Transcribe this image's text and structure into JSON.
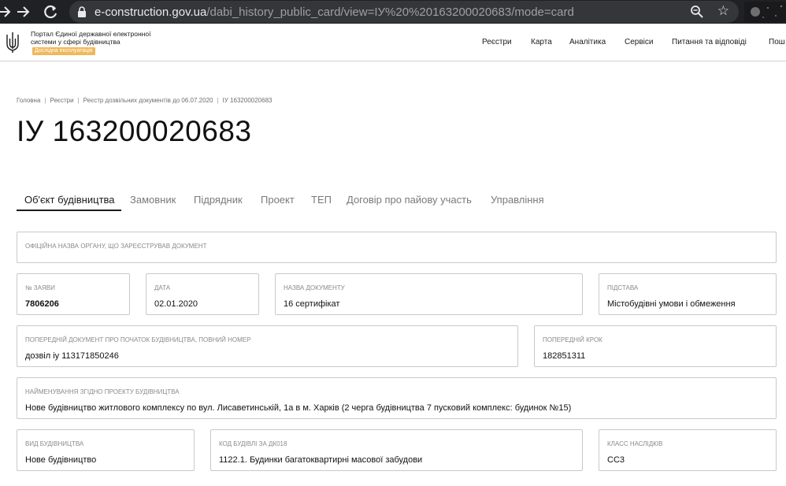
{
  "browser": {
    "url_host": "e-construction.gov.ua",
    "url_path": "/dabi_history_public_card/view=ІУ%20%20163200020683/mode=card"
  },
  "header": {
    "logo_text": "Портал Єдиної державної електронної системи у сфері будівництва",
    "beta_badge": "Дослідна експлуатація",
    "nav": [
      "Реєстри",
      "Карта",
      "Аналітика",
      "Сервіси",
      "Питання та відповіді",
      "Пош"
    ]
  },
  "breadcrumb": [
    "Головна",
    "Реєстри",
    "Реєстр дозвільних документів до 06.07.2020",
    "ІУ 163200020683"
  ],
  "title": "ІУ 163200020683",
  "tabs": [
    "Об'єкт будівництва",
    "Замовник",
    "Підрядник",
    "Проект",
    "ТЕП",
    "Договір про пайову участь",
    "Управління"
  ],
  "fields": {
    "issuing_body": {
      "label": "Офіційна назва органу, що зареєстрував документ",
      "value": ""
    },
    "application_no": {
      "label": "№ заяви",
      "value": "7806206"
    },
    "date": {
      "label": "Дата",
      "value": "02.01.2020"
    },
    "doc_name": {
      "label": "Назва документу",
      "value": "16 сертифікат"
    },
    "basis": {
      "label": "Підстава",
      "value": "Містобудівні умови і обмеження"
    },
    "prev_document": {
      "label": "Попередній документ про початок будівництва, повний номер",
      "value": "дозвіл іу 113171850246"
    },
    "prev_step": {
      "label": "Попередній крок",
      "value": "182851311"
    },
    "project_name": {
      "label": "Найменування згідно проекту будівництва",
      "value": "Нове будівництво житлового комплексу по вул. Лисаветинській, 1а в м. Харків (2 черга будівництва 7 пусковий комплекс: будинок №15)"
    },
    "construction_type": {
      "label": "Вид будівництва",
      "value": "Нове будівництво"
    },
    "building_code": {
      "label": "Код будівлі за ДК018",
      "value": "1122.1. Будинки багатоквартирні масової забудови"
    },
    "consequence_class": {
      "label": "Класс наслідків",
      "value": "СС3"
    }
  }
}
